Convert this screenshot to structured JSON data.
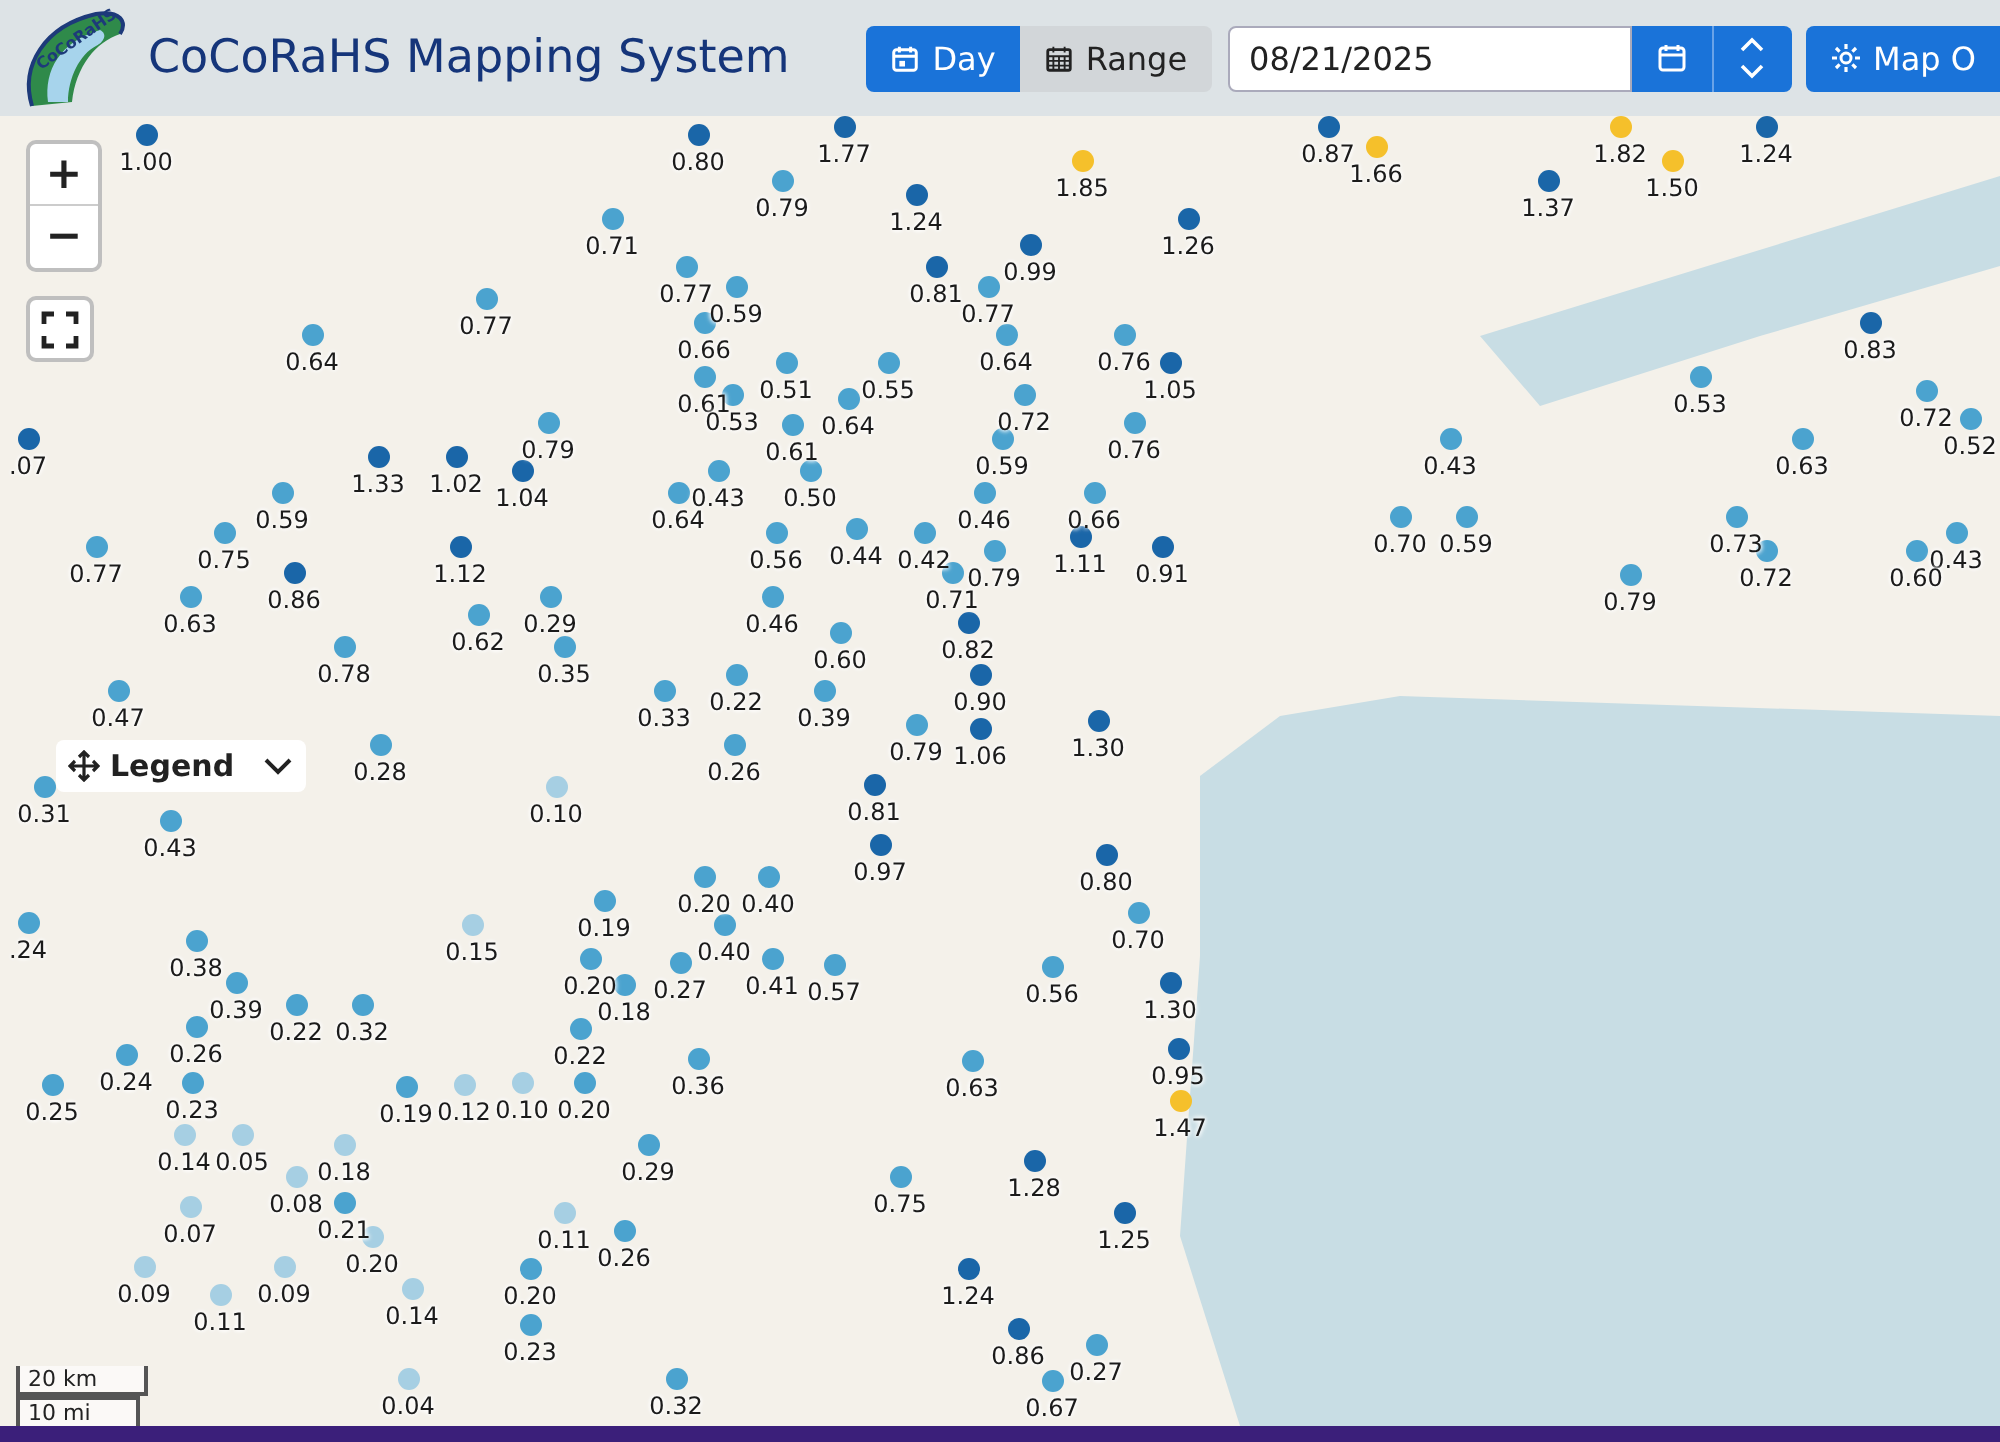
{
  "header": {
    "logo_text": "CoCoRaHS",
    "title": "CoCoRaHS Mapping System",
    "view_tabs": [
      {
        "label": "Day",
        "selected": true
      },
      {
        "label": "Range",
        "selected": false
      }
    ],
    "date_field": {
      "value": "08/21/2025"
    },
    "map_options_button": {
      "label": "Map O"
    }
  },
  "map": {
    "zoom_in": "+",
    "zoom_out": "−",
    "legend_label": "Legend",
    "scale": [
      "20 km",
      "10 mi"
    ],
    "markers": [
      {
        "value": "1.77",
        "color": "#1a66a8"
      },
      {
        "value": "0.87",
        "color": "#1a66a8"
      },
      {
        "value": "1.82",
        "color": "#f5c02b"
      },
      {
        "value": "1.24",
        "color": "#1a66a8"
      },
      {
        "value": "1.00",
        "color": "#1a66a8"
      },
      {
        "value": "0.80",
        "color": "#1a66a8"
      },
      {
        "value": "1.66",
        "color": "#f5c02b"
      },
      {
        "value": "1.85",
        "color": "#f5c02b"
      },
      {
        "value": "1.50",
        "color": "#f5c02b"
      },
      {
        "value": "0.79",
        "color": "#4ba3cf"
      },
      {
        "value": "1.37",
        "color": "#1a66a8"
      },
      {
        "value": "1.24",
        "color": "#1a66a8"
      },
      {
        "value": "0.71",
        "color": "#4ba3cf"
      },
      {
        "value": "1.26",
        "color": "#1a66a8"
      },
      {
        "value": "0.99",
        "color": "#1a66a8"
      },
      {
        "value": "0.77",
        "color": "#4ba3cf"
      },
      {
        "value": "0.81",
        "color": "#1a66a8"
      },
      {
        "value": "0.59",
        "color": "#4ba3cf"
      },
      {
        "value": "0.77",
        "color": "#4ba3cf"
      },
      {
        "value": "0.77",
        "color": "#4ba3cf"
      },
      {
        "value": "0.66",
        "color": "#4ba3cf"
      },
      {
        "value": "0.83",
        "color": "#1a66a8"
      },
      {
        "value": "0.64",
        "color": "#4ba3cf"
      },
      {
        "value": "0.64",
        "color": "#4ba3cf"
      },
      {
        "value": "0.76",
        "color": "#4ba3cf"
      },
      {
        "value": "0.51",
        "color": "#4ba3cf"
      },
      {
        "value": "0.55",
        "color": "#4ba3cf"
      },
      {
        "value": "1.05",
        "color": "#1a66a8"
      },
      {
        "value": "0.61",
        "color": "#4ba3cf"
      },
      {
        "value": "0.53",
        "color": "#4ba3cf"
      },
      {
        "value": "0.53",
        "color": "#4ba3cf"
      },
      {
        "value": "0.64",
        "color": "#4ba3cf"
      },
      {
        "value": "0.72",
        "color": "#4ba3cf"
      },
      {
        "value": "0.72",
        "color": "#4ba3cf"
      },
      {
        "value": "0.79",
        "color": "#4ba3cf"
      },
      {
        "value": "0.61",
        "color": "#4ba3cf"
      },
      {
        "value": "0.76",
        "color": "#4ba3cf"
      },
      {
        "value": "0.52",
        "color": "#4ba3cf"
      },
      {
        "value": ".07",
        "color": "#1a66a8"
      },
      {
        "value": "0.59",
        "color": "#4ba3cf"
      },
      {
        "value": "0.43",
        "color": "#4ba3cf"
      },
      {
        "value": "0.63",
        "color": "#4ba3cf"
      },
      {
        "value": "1.33",
        "color": "#1a66a8"
      },
      {
        "value": "1.02",
        "color": "#1a66a8"
      },
      {
        "value": "1.04",
        "color": "#1a66a8"
      },
      {
        "value": "0.43",
        "color": "#4ba3cf"
      },
      {
        "value": "0.50",
        "color": "#4ba3cf"
      },
      {
        "value": "0.59",
        "color": "#4ba3cf"
      },
      {
        "value": "0.64",
        "color": "#4ba3cf"
      },
      {
        "value": "0.46",
        "color": "#4ba3cf"
      },
      {
        "value": "0.66",
        "color": "#4ba3cf"
      },
      {
        "value": "0.70",
        "color": "#4ba3cf"
      },
      {
        "value": "0.59",
        "color": "#4ba3cf"
      },
      {
        "value": "0.73",
        "color": "#4ba3cf"
      },
      {
        "value": "0.75",
        "color": "#4ba3cf"
      },
      {
        "value": "0.56",
        "color": "#4ba3cf"
      },
      {
        "value": "0.44",
        "color": "#4ba3cf"
      },
      {
        "value": "0.42",
        "color": "#4ba3cf"
      },
      {
        "value": "1.11",
        "color": "#1a66a8"
      },
      {
        "value": "0.43",
        "color": "#4ba3cf"
      },
      {
        "value": "0.77",
        "color": "#4ba3cf"
      },
      {
        "value": "1.12",
        "color": "#1a66a8"
      },
      {
        "value": "0.79",
        "color": "#4ba3cf"
      },
      {
        "value": "0.91",
        "color": "#1a66a8"
      },
      {
        "value": "0.72",
        "color": "#4ba3cf"
      },
      {
        "value": "0.60",
        "color": "#4ba3cf"
      },
      {
        "value": "0.86",
        "color": "#1a66a8"
      },
      {
        "value": "0.71",
        "color": "#4ba3cf"
      },
      {
        "value": "0.79",
        "color": "#4ba3cf"
      },
      {
        "value": "0.63",
        "color": "#4ba3cf"
      },
      {
        "value": "0.29",
        "color": "#4ba3cf"
      },
      {
        "value": "0.46",
        "color": "#4ba3cf"
      },
      {
        "value": "0.62",
        "color": "#4ba3cf"
      },
      {
        "value": "0.82",
        "color": "#1a66a8"
      },
      {
        "value": "0.60",
        "color": "#4ba3cf"
      },
      {
        "value": "0.78",
        "color": "#4ba3cf"
      },
      {
        "value": "0.35",
        "color": "#4ba3cf"
      },
      {
        "value": "0.22",
        "color": "#4ba3cf"
      },
      {
        "value": "0.90",
        "color": "#1a66a8"
      },
      {
        "value": "0.47",
        "color": "#4ba3cf"
      },
      {
        "value": "0.33",
        "color": "#4ba3cf"
      },
      {
        "value": "0.39",
        "color": "#4ba3cf"
      },
      {
        "value": "0.79",
        "color": "#4ba3cf"
      },
      {
        "value": "1.06",
        "color": "#1a66a8"
      },
      {
        "value": "1.30",
        "color": "#1a66a8"
      },
      {
        "value": "0.28",
        "color": "#4ba3cf"
      },
      {
        "value": "0.26",
        "color": "#4ba3cf"
      },
      {
        "value": "0.31",
        "color": "#4ba3cf"
      },
      {
        "value": "0.10",
        "color": "#a6cfe3"
      },
      {
        "value": "0.81",
        "color": "#1a66a8"
      },
      {
        "value": "0.43",
        "color": "#4ba3cf"
      },
      {
        "value": "0.97",
        "color": "#1a66a8"
      },
      {
        "value": "0.80",
        "color": "#1a66a8"
      },
      {
        "value": "0.20",
        "color": "#4ba3cf"
      },
      {
        "value": "0.40",
        "color": "#4ba3cf"
      },
      {
        "value": "0.19",
        "color": "#4ba3cf"
      },
      {
        "value": "0.70",
        "color": "#4ba3cf"
      },
      {
        "value": ".24",
        "color": "#4ba3cf"
      },
      {
        "value": "0.15",
        "color": "#a6cfe3"
      },
      {
        "value": "0.40",
        "color": "#4ba3cf"
      },
      {
        "value": "0.38",
        "color": "#4ba3cf"
      },
      {
        "value": "0.20",
        "color": "#4ba3cf"
      },
      {
        "value": "0.27",
        "color": "#4ba3cf"
      },
      {
        "value": "0.41",
        "color": "#4ba3cf"
      },
      {
        "value": "0.57",
        "color": "#4ba3cf"
      },
      {
        "value": "0.56",
        "color": "#4ba3cf"
      },
      {
        "value": "0.39",
        "color": "#4ba3cf"
      },
      {
        "value": "0.18",
        "color": "#4ba3cf"
      },
      {
        "value": "1.30",
        "color": "#1a66a8"
      },
      {
        "value": "0.22",
        "color": "#4ba3cf"
      },
      {
        "value": "0.32",
        "color": "#4ba3cf"
      },
      {
        "value": "0.26",
        "color": "#4ba3cf"
      },
      {
        "value": "0.22",
        "color": "#4ba3cf"
      },
      {
        "value": "0.24",
        "color": "#4ba3cf"
      },
      {
        "value": "0.36",
        "color": "#4ba3cf"
      },
      {
        "value": "0.63",
        "color": "#4ba3cf"
      },
      {
        "value": "0.95",
        "color": "#1a66a8"
      },
      {
        "value": "0.25",
        "color": "#4ba3cf"
      },
      {
        "value": "0.23",
        "color": "#4ba3cf"
      },
      {
        "value": "0.19",
        "color": "#4ba3cf"
      },
      {
        "value": "0.12",
        "color": "#a6cfe3"
      },
      {
        "value": "0.10",
        "color": "#a6cfe3"
      },
      {
        "value": "0.20",
        "color": "#4ba3cf"
      },
      {
        "value": "1.47",
        "color": "#f5c02b"
      },
      {
        "value": "0.14",
        "color": "#a6cfe3"
      },
      {
        "value": "0.05",
        "color": "#a6cfe3"
      },
      {
        "value": "0.18",
        "color": "#a6cfe3"
      },
      {
        "value": "0.29",
        "color": "#4ba3cf"
      },
      {
        "value": "1.28",
        "color": "#1a66a8"
      },
      {
        "value": "0.08",
        "color": "#a6cfe3"
      },
      {
        "value": "0.75",
        "color": "#4ba3cf"
      },
      {
        "value": "0.07",
        "color": "#a6cfe3"
      },
      {
        "value": "0.21",
        "color": "#4ba3cf"
      },
      {
        "value": "0.11",
        "color": "#a6cfe3"
      },
      {
        "value": "1.25",
        "color": "#1a66a8"
      },
      {
        "value": "0.20",
        "color": "#a6cfe3"
      },
      {
        "value": "0.26",
        "color": "#4ba3cf"
      },
      {
        "value": "0.09",
        "color": "#a6cfe3"
      },
      {
        "value": "0.09",
        "color": "#a6cfe3"
      },
      {
        "value": "0.20",
        "color": "#4ba3cf"
      },
      {
        "value": "1.24",
        "color": "#1a66a8"
      },
      {
        "value": "0.11",
        "color": "#a6cfe3"
      },
      {
        "value": "0.14",
        "color": "#a6cfe3"
      },
      {
        "value": "0.23",
        "color": "#4ba3cf"
      },
      {
        "value": "0.86",
        "color": "#1a66a8"
      },
      {
        "value": "0.27",
        "color": "#4ba3cf"
      },
      {
        "value": "0.04",
        "color": "#a6cfe3"
      },
      {
        "value": "0.32",
        "color": "#4ba3cf"
      },
      {
        "value": "0.67",
        "color": "#4ba3cf"
      }
    ]
  }
}
